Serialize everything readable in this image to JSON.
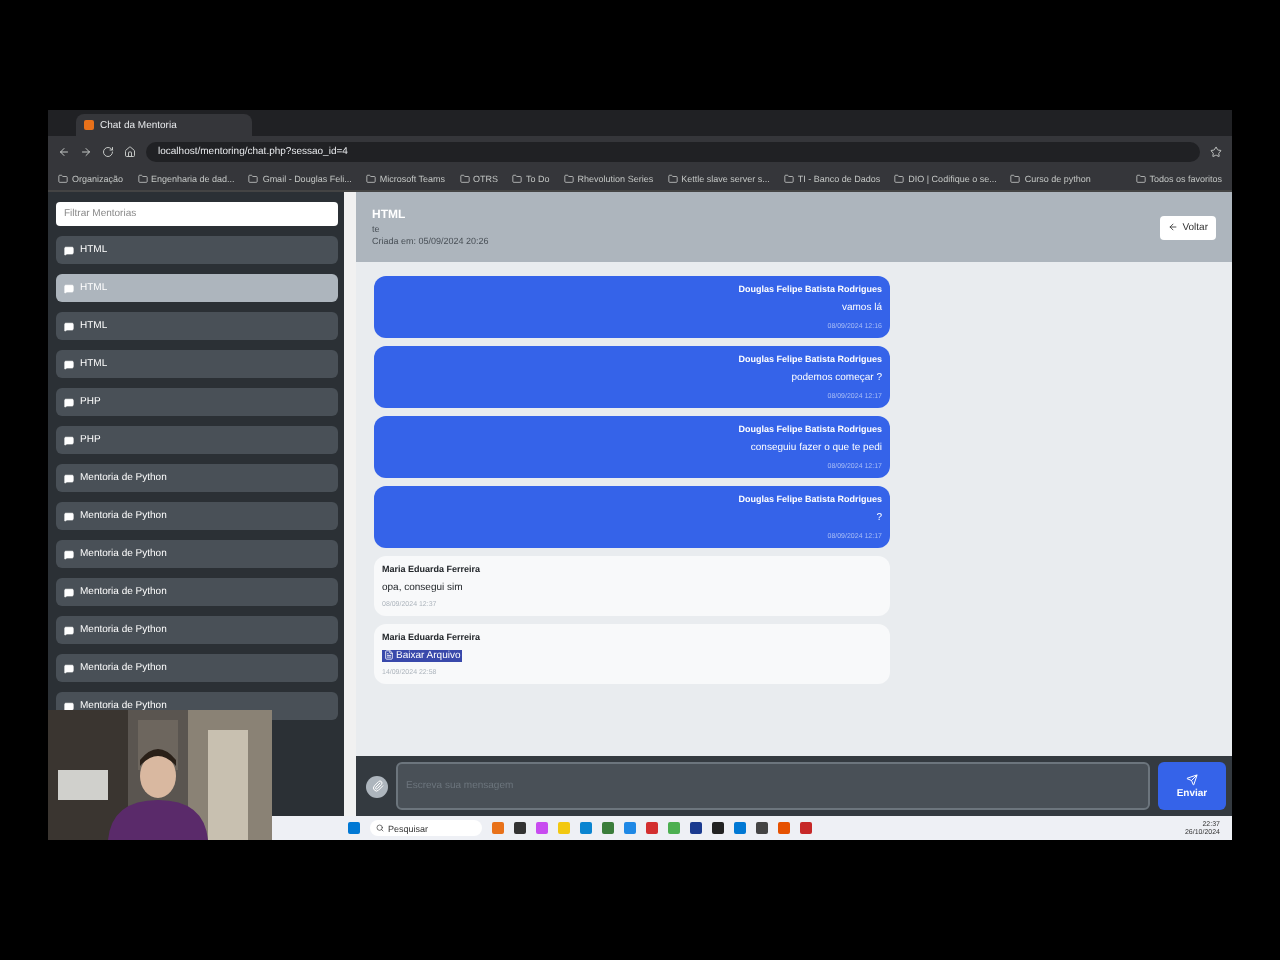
{
  "browser": {
    "tab_title": "Chat da Mentoria",
    "url": "localhost/mentoring/chat.php?sessao_id=4",
    "bookmarks": [
      "Organização",
      "Engenharia de dad...",
      "Gmail - Douglas Feli...",
      "Microsoft Teams",
      "OTRS",
      "To Do",
      "Rhevolution Series",
      "Kettle slave server s...",
      "TI - Banco de Dados",
      "DIO | Codifique o se...",
      "Curso de python"
    ],
    "all_bookmarks": "Todos os favoritos"
  },
  "sidebar": {
    "filter_placeholder": "Filtrar Mentorias",
    "items": [
      {
        "label": "HTML",
        "selected": false
      },
      {
        "label": "HTML",
        "selected": true
      },
      {
        "label": "HTML",
        "selected": false
      },
      {
        "label": "HTML",
        "selected": false
      },
      {
        "label": "PHP",
        "selected": false
      },
      {
        "label": "PHP",
        "selected": false
      },
      {
        "label": "Mentoria de Python",
        "selected": false
      },
      {
        "label": "Mentoria de Python",
        "selected": false
      },
      {
        "label": "Mentoria de Python",
        "selected": false
      },
      {
        "label": "Mentoria de Python",
        "selected": false
      },
      {
        "label": "Mentoria de Python",
        "selected": false
      },
      {
        "label": "Mentoria de Python",
        "selected": false
      },
      {
        "label": "Mentoria de Python",
        "selected": false
      }
    ]
  },
  "chat": {
    "title": "HTML",
    "subtitle": "te",
    "created": "Criada em: 05/09/2024 20:26",
    "back_button": "Voltar",
    "messages": [
      {
        "kind": "sent",
        "author": "Douglas Felipe Batista Rodrigues",
        "text": "vamos lá",
        "time": "08/09/2024 12:16"
      },
      {
        "kind": "sent",
        "author": "Douglas Felipe Batista Rodrigues",
        "text": "podemos começar ?",
        "time": "08/09/2024 12:17"
      },
      {
        "kind": "sent",
        "author": "Douglas Felipe Batista Rodrigues",
        "text": "conseguiu fazer o que te pedi",
        "time": "08/09/2024 12:17"
      },
      {
        "kind": "sent",
        "author": "Douglas Felipe Batista Rodrigues",
        "text": "?",
        "time": "08/09/2024 12:17"
      },
      {
        "kind": "received",
        "author": "Maria Eduarda Ferreira",
        "text": "opa, consegui sim",
        "time": "08/09/2024 12:37"
      },
      {
        "kind": "file",
        "author": "Maria Eduarda Ferreira",
        "text": "Baixar Arquivo",
        "time": "14/09/2024 22:58"
      }
    ],
    "composer": {
      "placeholder": "Escreva sua mensagem",
      "send": "Enviar"
    }
  },
  "taskbar": {
    "search": "Pesquisar",
    "time": "22:37",
    "date": "26/10/2024"
  }
}
